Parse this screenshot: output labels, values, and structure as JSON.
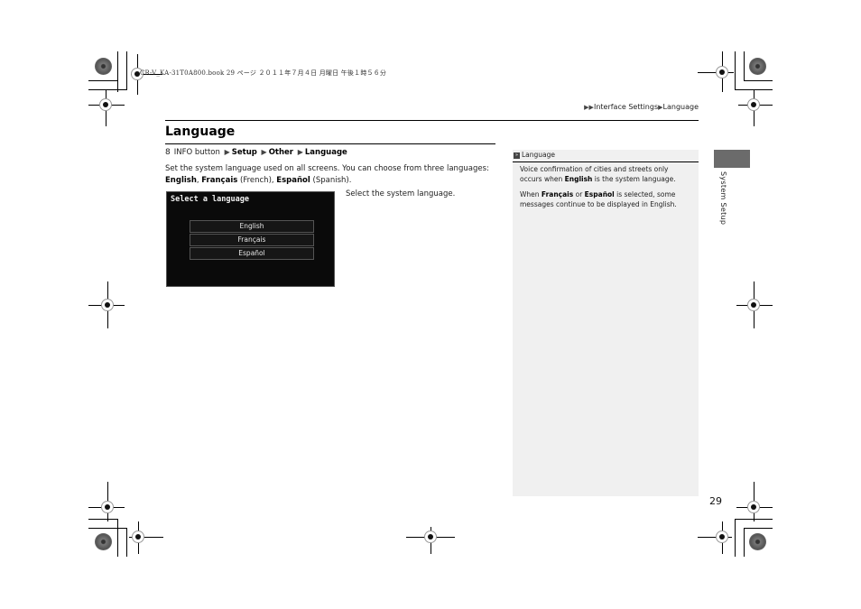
{
  "print_header": "CR-V_KA-31T0A800.book  29 ページ  ２０１１年７月４日  月曜日  午後１時５６分",
  "breadcrumb": {
    "arrow_icons": "arrow-right-icon",
    "items": [
      "Interface Settings",
      "Language"
    ]
  },
  "section": {
    "title": "Language",
    "path": {
      "icon": "info-icon",
      "start": "INFO button",
      "steps": [
        "Setup",
        "Other",
        "Language"
      ]
    },
    "description": {
      "text_before": "Set the system language used on all screens. You can choose from three languages: ",
      "options": [
        {
          "name": "English",
          "note": ""
        },
        {
          "name": "Français",
          "note": " (French)"
        },
        {
          "name": "Español",
          "note": " (Spanish)"
        }
      ],
      "sep": ", ",
      "end": "."
    }
  },
  "screen": {
    "title": "Select a language",
    "options": [
      "English",
      "Français",
      "Español"
    ],
    "caption": "Select the system language."
  },
  "sidebar": {
    "heading": "Language",
    "para1": {
      "a": "Voice confirmation of cities and streets only occurs when ",
      "b": "English",
      "c": " is the system language."
    },
    "para2": {
      "a": "When ",
      "b": "Français",
      "c": " or ",
      "d": "Español",
      "e": " is selected, some messages continue to be displayed in English."
    }
  },
  "side_tab": {
    "label": "System Setup"
  },
  "page_number": "29"
}
